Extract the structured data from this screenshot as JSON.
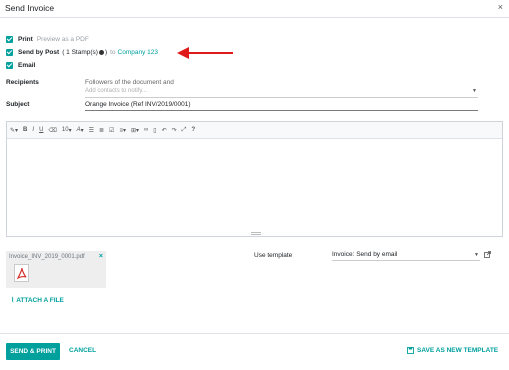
{
  "dialog": {
    "title": "Send Invoice",
    "close_icon": "close-icon"
  },
  "options": {
    "print": {
      "label": "Print",
      "hint": "Preview as a PDF",
      "checked": true
    },
    "post": {
      "label": "Send by Post",
      "stamps": "( 1 Stamp(s)",
      "stamps_close": ")",
      "to": "to",
      "partner": "Company 123",
      "checked": true
    },
    "email": {
      "label": "Email",
      "checked": true
    }
  },
  "recipients": {
    "label": "Recipients",
    "followers_text": "Followers of the document and",
    "placeholder": "Add contacts to notify..."
  },
  "subject": {
    "label": "Subject",
    "value": "Orange Invoice (Ref INV/2019/0001)"
  },
  "editor": {
    "toolbar": [
      "magic-wand-icon",
      "bold-icon",
      "italic-icon",
      "underline-icon",
      "eraser-icon",
      "font-size-dropdown",
      "font-color-icon",
      "bullet-list-icon",
      "numbered-list-icon",
      "checklist-icon",
      "align-dropdown",
      "table-dropdown",
      "link-icon",
      "file-icon",
      "undo-icon",
      "redo-icon",
      "fullscreen-icon",
      "help-icon"
    ],
    "font_size": "10",
    "help_text": "?"
  },
  "attachment": {
    "filename": "Invoice_INV_2019_0001.pdf",
    "type_icon": "pdf-icon",
    "attach_label": "ATTACH A FILE"
  },
  "template": {
    "label": "Use template",
    "value": "Invoice: Send by email"
  },
  "footer": {
    "send_label": "SEND & PRINT",
    "cancel_label": "CANCEL",
    "save_template_label": "SAVE AS NEW TEMPLATE"
  },
  "colors": {
    "accent": "#00a09d",
    "arrow": "#e0191b",
    "pdf_red": "#d2322d"
  }
}
